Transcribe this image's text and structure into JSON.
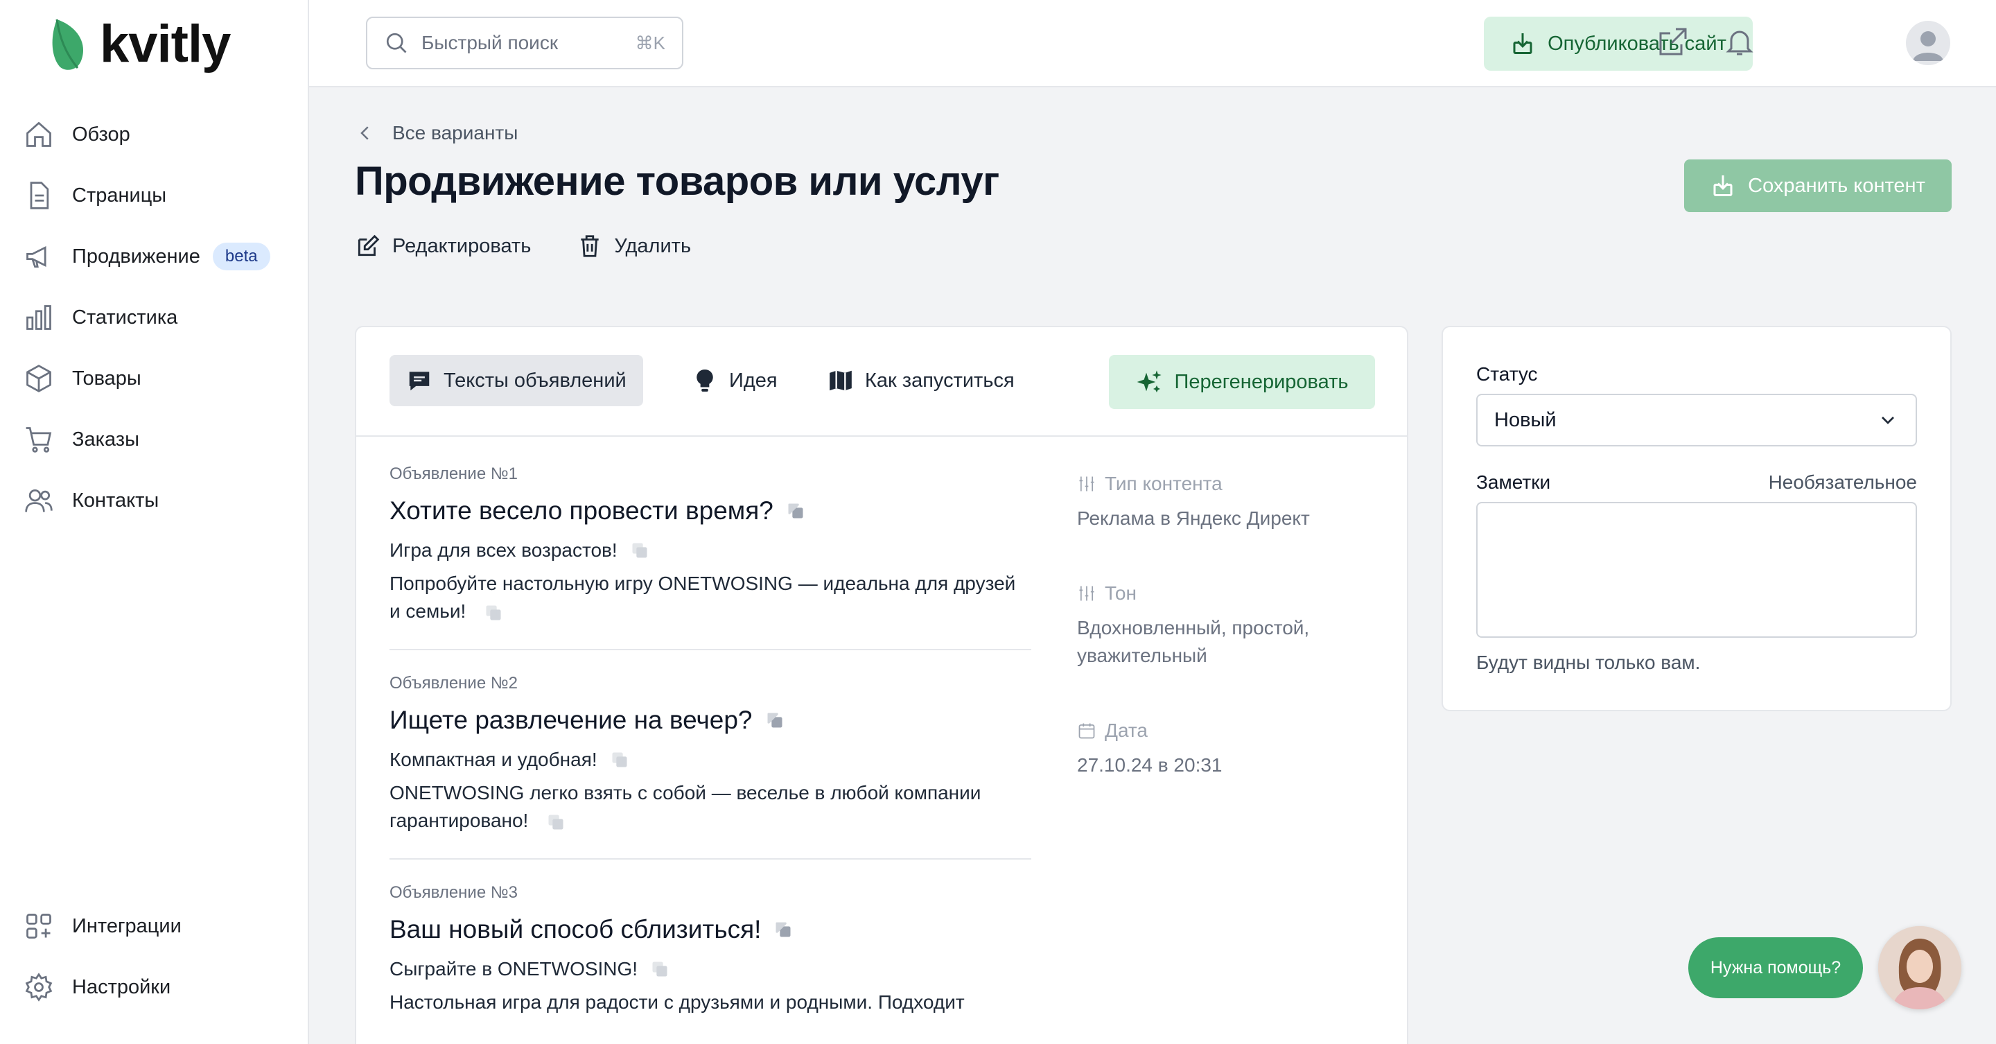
{
  "brand": {
    "name": "kvitly",
    "color": "#3da86a"
  },
  "sidebar": {
    "items": [
      {
        "label": "Обзор",
        "icon": "home-icon"
      },
      {
        "label": "Страницы",
        "icon": "page-icon"
      },
      {
        "label": "Продвижение",
        "icon": "megaphone-icon",
        "badge": "beta"
      },
      {
        "label": "Статистика",
        "icon": "bar-chart-icon"
      },
      {
        "label": "Товары",
        "icon": "cube-icon"
      },
      {
        "label": "Заказы",
        "icon": "cart-icon"
      },
      {
        "label": "Контакты",
        "icon": "users-icon"
      }
    ],
    "bottom": [
      {
        "label": "Интеграции",
        "icon": "integrations-icon"
      },
      {
        "label": "Настройки",
        "icon": "gear-icon"
      }
    ]
  },
  "topbar": {
    "search_placeholder": "Быстрый поиск",
    "search_shortcut": "⌘K",
    "publish_label": "Опубликовать сайт"
  },
  "header": {
    "back_label": "Все варианты",
    "title": "Продвижение товаров или услуг",
    "edit_label": "Редактировать",
    "delete_label": "Удалить",
    "save_label": "Сохранить контент"
  },
  "tabs": [
    {
      "label": "Тексты объявлений",
      "icon": "chat-icon",
      "active": true
    },
    {
      "label": "Идея",
      "icon": "bulb-icon",
      "active": false
    },
    {
      "label": "Как запуститься",
      "icon": "map-icon",
      "active": false
    }
  ],
  "regenerate_label": "Перегенерировать",
  "ads": [
    {
      "number": "Объявление №1",
      "title": "Хотите весело провести время?",
      "subtitle": "Игра для всех возрастов!",
      "body": "Попробуйте настольную игру ONETWOSING — идеальна для друзей и семьи!"
    },
    {
      "number": "Объявление №2",
      "title": "Ищете развлечение на вечер?",
      "subtitle": "Компактная и удобная!",
      "body": "ONETWOSING легко взять с собой — веселье в любой компании гарантировано!"
    },
    {
      "number": "Объявление №3",
      "title": "Ваш новый способ сблизиться!",
      "subtitle": "Сыграйте в ONETWOSING!",
      "body": "Настольная игра для радости с друзьями и родными. Подходит"
    }
  ],
  "meta": {
    "content_type_label": "Тип контента",
    "content_type_value": "Реклама в Яндекс Директ",
    "tone_label": "Тон",
    "tone_value": "Вдохновленный, простой, уважительный",
    "date_label": "Дата",
    "date_value": "27.10.24 в 20:31"
  },
  "panel": {
    "status_label": "Статус",
    "status_value": "Новый",
    "notes_label": "Заметки",
    "notes_optional": "Необязательное",
    "notes_hint": "Будут видны только вам."
  },
  "help": {
    "label": "Нужна помощь?"
  }
}
